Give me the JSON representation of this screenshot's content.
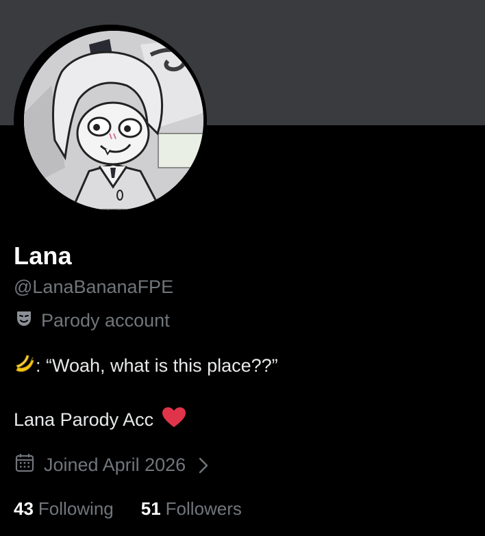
{
  "profile": {
    "display_name": "Lana",
    "handle": "@LanaBananaFPE",
    "parody_label": "Parody account",
    "bio_line1_text": ": “Woah, what is this place??”",
    "bio_line2_text": "Lana Parody Acc",
    "joined_text": "Joined April 2026",
    "following_count": "43",
    "following_label": "Following",
    "followers_count": "51",
    "followers_label": "Followers"
  },
  "icons": {
    "parody": "theater-mask-icon",
    "bio_emoji": "banana-icon",
    "bio_heart": "red-heart-icon",
    "joined": "calendar-icon",
    "chevron": "chevron-right-icon"
  },
  "colors": {
    "background": "#000000",
    "banner": "#3a3b3f",
    "primary_text": "#e7e9ea",
    "secondary_text": "#71767b",
    "heart": "#e0344a",
    "banana": "#f5c518"
  }
}
